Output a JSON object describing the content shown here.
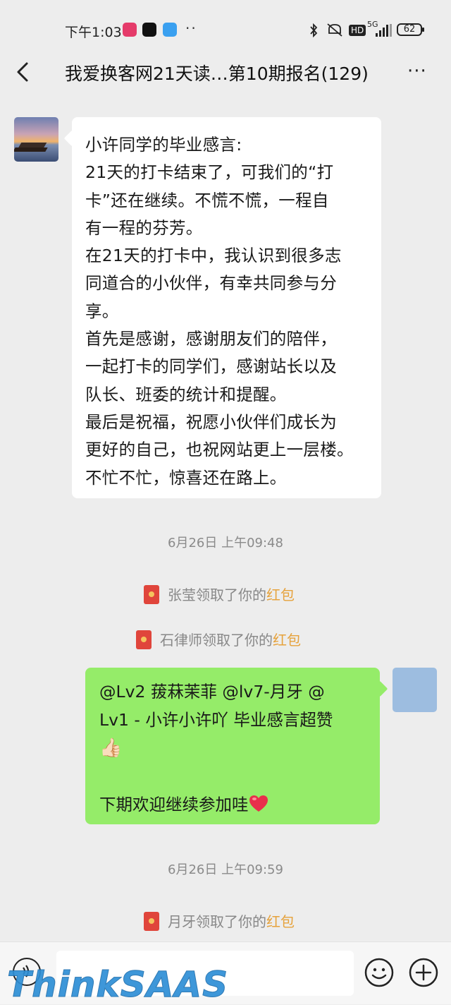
{
  "status_bar": {
    "time": "下午1:03",
    "network": "5G",
    "hd": "HD",
    "battery": "62"
  },
  "header": {
    "title": "我爱换客网21天读…第10期报名(129)",
    "more": "···"
  },
  "messages": {
    "left_bubble": {
      "lines": [
        "小许同学的毕业感言:",
        "21天的打卡结束了，可我们的“打",
        "卡”还在继续。不慌不慌，一程自",
        "有一程的芬芳。",
        "在21天的打卡中，我认识到很多志",
        "同道合的小伙伴，有幸共同参与分",
        "享。",
        "首先是感谢，感谢朋友们的陪伴，",
        "一起打卡的同学们，感谢站长以及",
        "队长、班委的统计和提醒。",
        "最后是祝福，祝愿小伙伴们成长为",
        "更好的自己，也祝网站更上一层楼。",
        "不忙不忙，惊喜还在路上。"
      ]
    },
    "timestamp_1": "6月26日 上午09:48",
    "system_1": {
      "prefix": "张莹领取了你的",
      "highlight": "红包"
    },
    "system_2": {
      "prefix": "石律师领取了你的",
      "highlight": "红包"
    },
    "right_bubble": {
      "line_1": "@Lv2 菝菻茉菲 @lv7-月牙 @",
      "line_2": "Lv1 - 小许小许吖  毕业感言超赞",
      "thumb": "👍🏻",
      "line_4": "下期欢迎继续参加哇"
    },
    "timestamp_2": "6月26日 上午09:59",
    "system_3": {
      "prefix": "月牙领取了你的",
      "highlight": "红包"
    }
  },
  "input_bar": {
    "placeholder": ""
  },
  "watermark": "ThinkSAAS",
  "colors": {
    "background": "#ededed",
    "self_bubble": "#95ec69",
    "other_bubble": "#ffffff",
    "red_packet_highlight": "#e6a23c",
    "red_packet_icon": "#e0453b",
    "watermark": "#2e8fd6"
  },
  "icons": [
    "back-arrow-icon",
    "more-icon",
    "voice-icon",
    "emoji-icon",
    "plus-icon",
    "red-packet-icon",
    "heart-emoji-icon",
    "thumbs-up-emoji-icon"
  ]
}
